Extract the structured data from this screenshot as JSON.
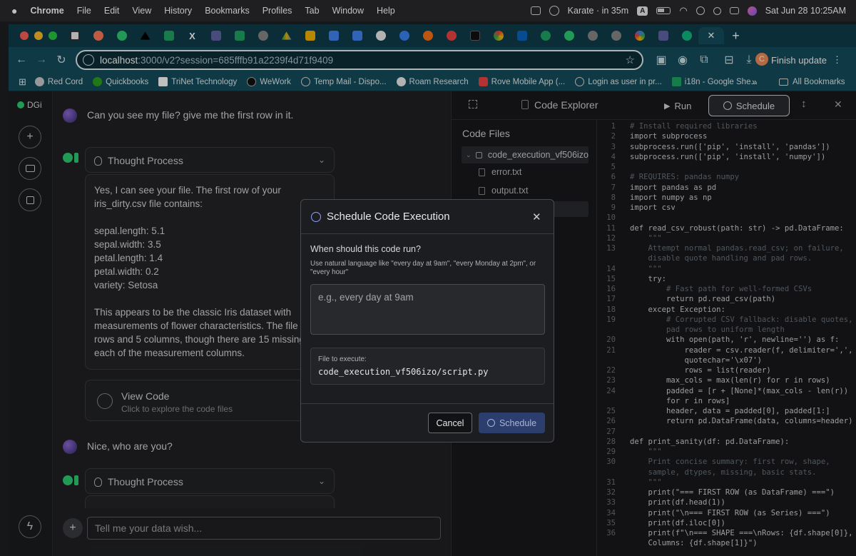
{
  "menubar": {
    "app": "Chrome",
    "items": [
      "File",
      "Edit",
      "View",
      "History",
      "Bookmarks",
      "Profiles",
      "Tab",
      "Window",
      "Help"
    ],
    "status": "Karate · in 35m",
    "input_source": "A",
    "datetime": "Sat Jun 28  10:25AM"
  },
  "toolbar": {
    "url_host": "localhost",
    "url_path": ":3000/v2?session=685fffb91a2239f4d71f9409",
    "finish_update": "Finish update",
    "profile_initial": "C"
  },
  "bookmarks": {
    "items": [
      "Red Cord",
      "Quickbooks",
      "TriNet Technology",
      "WeWork",
      "Temp Mail - Dispo...",
      "Roam Research",
      "Rove Mobile App (...",
      "Login as user in pr...",
      "i18n - Google She..."
    ],
    "all": "All Bookmarks"
  },
  "rail": {
    "brand": "DGi"
  },
  "chat": {
    "q1": "Can you see my file? give me the first row in it.",
    "thought_label": "Thought Process",
    "answer": "Yes, I can see your file. The first row of your iris_dirty.csv file contains:\n\nsepal.length: 5.1\nsepal.width: 3.5\npetal.length: 1.4\npetal.width: 0.2\nvariety: Setosa\n\nThis appears to be the classic Iris dataset with measurements of flower characteristics. The file has rows and 5 columns, though there are 15 missing va in each of the measurement columns.",
    "view_code_title": "View Code",
    "view_code_sub": "Click to explore the code files",
    "q2": "Nice, who are you?",
    "thought_label2": "Thought Process",
    "composer_placeholder": "Tell me your data wish..."
  },
  "explorer": {
    "title": "Code Explorer",
    "run": "Run",
    "schedule": "Schedule",
    "files_title": "Code Files",
    "folder": "code_execution_vf506izo",
    "files": [
      "error.txt",
      "output.txt"
    ]
  },
  "code_lines": [
    {
      "n": "1",
      "t": "# Install required libraries",
      "c": "cm"
    },
    {
      "n": "2",
      "t": "import subprocess",
      "c": ""
    },
    {
      "n": "3",
      "t": "subprocess.run(['pip', 'install', 'pandas'])",
      "c": ""
    },
    {
      "n": "4",
      "t": "subprocess.run(['pip', 'install', 'numpy'])",
      "c": ""
    },
    {
      "n": "5",
      "t": "",
      "c": ""
    },
    {
      "n": "6",
      "t": "# REQUIRES: pandas numpy",
      "c": "cm"
    },
    {
      "n": "7",
      "t": "import pandas as pd",
      "c": ""
    },
    {
      "n": "8",
      "t": "import numpy as np",
      "c": ""
    },
    {
      "n": "9",
      "t": "import csv",
      "c": ""
    },
    {
      "n": "10",
      "t": "",
      "c": ""
    },
    {
      "n": "11",
      "t": "def read_csv_robust(path: str) -> pd.DataFrame:",
      "c": ""
    },
    {
      "n": "12",
      "t": "    \"\"\"",
      "c": "cm"
    },
    {
      "n": "13",
      "t": "    Attempt normal pandas.read_csv; on failure,",
      "c": "cm"
    },
    {
      "n": "",
      "t": "    disable quote handling and pad rows.",
      "c": "cm"
    },
    {
      "n": "14",
      "t": "    \"\"\"",
      "c": "cm"
    },
    {
      "n": "15",
      "t": "    try:",
      "c": ""
    },
    {
      "n": "16",
      "t": "        # Fast path for well-formed CSVs",
      "c": "cm"
    },
    {
      "n": "17",
      "t": "        return pd.read_csv(path)",
      "c": ""
    },
    {
      "n": "18",
      "t": "    except Exception:",
      "c": ""
    },
    {
      "n": "19",
      "t": "        # Corrupted CSV fallback: disable quotes,",
      "c": "cm"
    },
    {
      "n": "",
      "t": "        pad rows to uniform length",
      "c": "cm"
    },
    {
      "n": "20",
      "t": "        with open(path, 'r', newline='') as f:",
      "c": ""
    },
    {
      "n": "21",
      "t": "            reader = csv.reader(f, delimiter=',',",
      "c": ""
    },
    {
      "n": "",
      "t": "            quotechar='\\x07')",
      "c": ""
    },
    {
      "n": "22",
      "t": "            rows = list(reader)",
      "c": ""
    },
    {
      "n": "23",
      "t": "        max_cols = max(len(r) for r in rows)",
      "c": ""
    },
    {
      "n": "24",
      "t": "        padded = [r + [None]*(max_cols - len(r))",
      "c": ""
    },
    {
      "n": "",
      "t": "        for r in rows]",
      "c": ""
    },
    {
      "n": "25",
      "t": "        header, data = padded[0], padded[1:]",
      "c": ""
    },
    {
      "n": "26",
      "t": "        return pd.DataFrame(data, columns=header)",
      "c": ""
    },
    {
      "n": "27",
      "t": "",
      "c": ""
    },
    {
      "n": "28",
      "t": "def print_sanity(df: pd.DataFrame):",
      "c": ""
    },
    {
      "n": "29",
      "t": "    \"\"\"",
      "c": "cm"
    },
    {
      "n": "30",
      "t": "    Print concise summary: first row, shape,",
      "c": "cm"
    },
    {
      "n": "",
      "t": "    sample, dtypes, missing, basic stats.",
      "c": "cm"
    },
    {
      "n": "31",
      "t": "    \"\"\"",
      "c": "cm"
    },
    {
      "n": "32",
      "t": "    print(\"=== FIRST ROW (as DataFrame) ===\")",
      "c": ""
    },
    {
      "n": "33",
      "t": "    print(df.head(1))",
      "c": ""
    },
    {
      "n": "34",
      "t": "    print(\"\\n=== FIRST ROW (as Series) ===\")",
      "c": ""
    },
    {
      "n": "35",
      "t": "    print(df.iloc[0])",
      "c": ""
    },
    {
      "n": "36",
      "t": "    print(f\"\\n=== SHAPE ===\\nRows: {df.shape[0]},",
      "c": ""
    },
    {
      "n": "",
      "t": "    Columns: {df.shape[1]}\")",
      "c": ""
    }
  ],
  "dialog": {
    "title": "Schedule Code Execution",
    "question": "When should this code run?",
    "hint": "Use natural language like \"every day at 9am\", \"every Monday at 2pm\", or \"every hour\"",
    "placeholder": "e.g., every day at 9am",
    "file_label": "File to execute:",
    "file_path": "code_execution_vf506izo/script.py",
    "cancel": "Cancel",
    "schedule": "Schedule"
  },
  "colors": {
    "accent": "#3b5bdb",
    "chrome_teal": "#134d5c"
  }
}
